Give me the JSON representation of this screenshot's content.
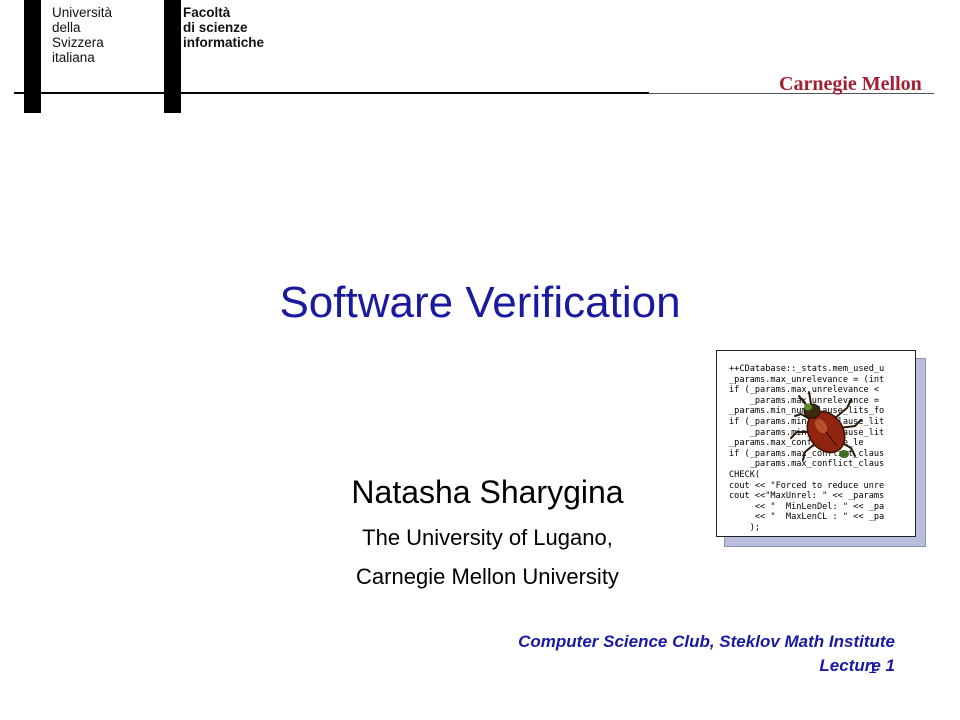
{
  "header": {
    "usi_lines": [
      "Università",
      "della",
      "Svizzera",
      "italiana"
    ],
    "faculty_lines": [
      "Facoltà",
      "di scienze",
      "informatiche"
    ],
    "cmu_logo": "Carnegie Mellon",
    "cmu_color": "#a31f34"
  },
  "slide": {
    "title": "Software Verification",
    "author": "Natasha Sharygina",
    "affiliation_1": "The University of Lugano,",
    "affiliation_2": "Carnegie Mellon University",
    "event_line_1": "Computer Science Club, Steklov Math Institute",
    "event_line_2": "Lecture 1",
    "page_number": "1",
    "title_color": "#1a1aa0"
  },
  "code_image": {
    "icon": "bug-icon",
    "lines": [
      "++CDatabase::_stats.mem_used_u",
      "_params.max_unrelevance = (int",
      "if (_params.max_unrelevance <",
      "    _params.max_unrelevance =",
      "_params.min_num_clause_lits_fo",
      "if (_params.min_num_clause_lit",
      "    _params.min_num_clause_lit",
      "_params.max_conf_clause_le",
      "if (_params.max_conflict_claus",
      "    _params.max_conflict_claus",
      "CHECK(",
      "cout << \"Forced to reduce unre",
      "cout <<\"MaxUnrel: \" << _params",
      "     << \"  MinLenDel: \" << _pa",
      "     << \"  MaxLenCL : \" << _pa",
      "    );"
    ]
  }
}
